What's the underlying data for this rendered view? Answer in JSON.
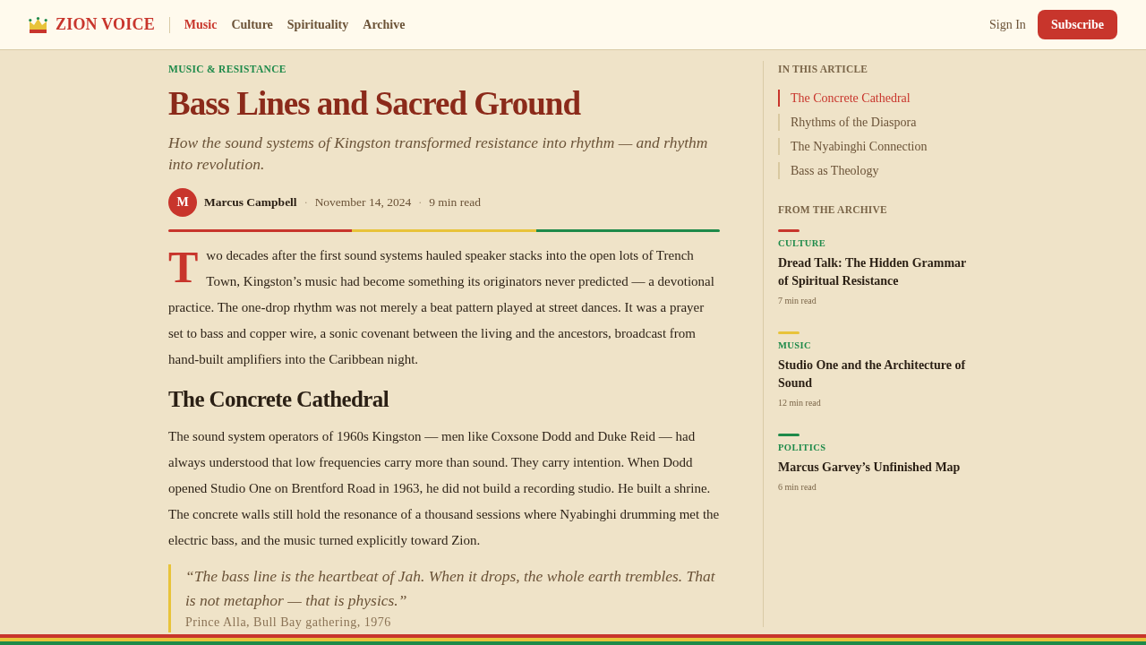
{
  "header": {
    "logo": "ZION VOICE",
    "nav": [
      {
        "label": "Music",
        "selected": true
      },
      {
        "label": "Culture",
        "selected": false
      },
      {
        "label": "Spirituality",
        "selected": false
      },
      {
        "label": "Archive",
        "selected": false
      }
    ],
    "sign_in": "Sign In",
    "subscribe": "Subscribe"
  },
  "article": {
    "category": "MUSIC & RESISTANCE",
    "title": "Bass Lines and Sacred Ground",
    "subtitle": "How the sound systems of Kingston transformed resistance into rhythm — and rhythm into revolution.",
    "author": {
      "initial": "M",
      "meta": [
        {
          "kind": "author",
          "text": "Marcus Campbell"
        },
        {
          "kind": "separator",
          "text": "·"
        },
        {
          "kind": "date",
          "text": "November 14, 2024"
        },
        {
          "kind": "separator",
          "text": "·"
        },
        {
          "kind": "read_time",
          "text": "9 min read"
        }
      ]
    },
    "body": [
      {
        "kind": "paragraph",
        "drop_cap": true,
        "text": "Two decades after the first sound systems hauled speaker stacks into the open lots of Trench Town, Kingston’s music had become something its originators never predicted — a devotional practice. The one-drop rhythm was not merely a beat pattern played at street dances. It was a prayer set to bass and copper wire, a sonic covenant between the living and the ancestors, broadcast from hand-built amplifiers into the Caribbean night."
      },
      {
        "kind": "heading",
        "text": "The Concrete Cathedral"
      },
      {
        "kind": "paragraph",
        "drop_cap": false,
        "text": "The sound system operators of 1960s Kingston — men like Coxsone Dodd and Duke Reid — had always understood that low frequencies carry more than sound. They carry intention. When Dodd opened Studio One on Brentford Road in 1963, he did not build a recording studio. He built a shrine. The concrete walls still hold the resonance of a thousand sessions where Nyabinghi drumming met the electric bass, and the music turned explicitly toward Zion."
      },
      {
        "kind": "quote",
        "text": "“The bass line is the heartbeat of Jah. When it drops, the whole earth trembles. That is not metaphor — that is physics.”",
        "cite": "Prince Alla, Bull Bay gathering, 1976"
      }
    ]
  },
  "sidebar": {
    "toc": {
      "heading": "IN THIS ARTICLE",
      "items": [
        {
          "label": "The Concrete Cathedral",
          "selected": true
        },
        {
          "label": "Rhythms of the Diaspora",
          "selected": false
        },
        {
          "label": "The Nyabinghi Connection",
          "selected": false
        },
        {
          "label": "Bass as Theology",
          "selected": false
        }
      ]
    },
    "archive": {
      "heading": "FROM THE ARCHIVE",
      "items": [
        {
          "color": "#c8352c",
          "category": "CULTURE",
          "title": "Dread Talk: The Hidden Grammar of Spiritual Resistance",
          "read_time": "7 min read"
        },
        {
          "color": "#e8c33a",
          "category": "MUSIC",
          "title": "Studio One and the Architecture of Sound",
          "read_time": "12 min read"
        },
        {
          "color": "#1e8a4a",
          "category": "POLITICS",
          "title": "Marcus Garvey’s Unfinished Map",
          "read_time": "6 min read"
        }
      ]
    }
  }
}
